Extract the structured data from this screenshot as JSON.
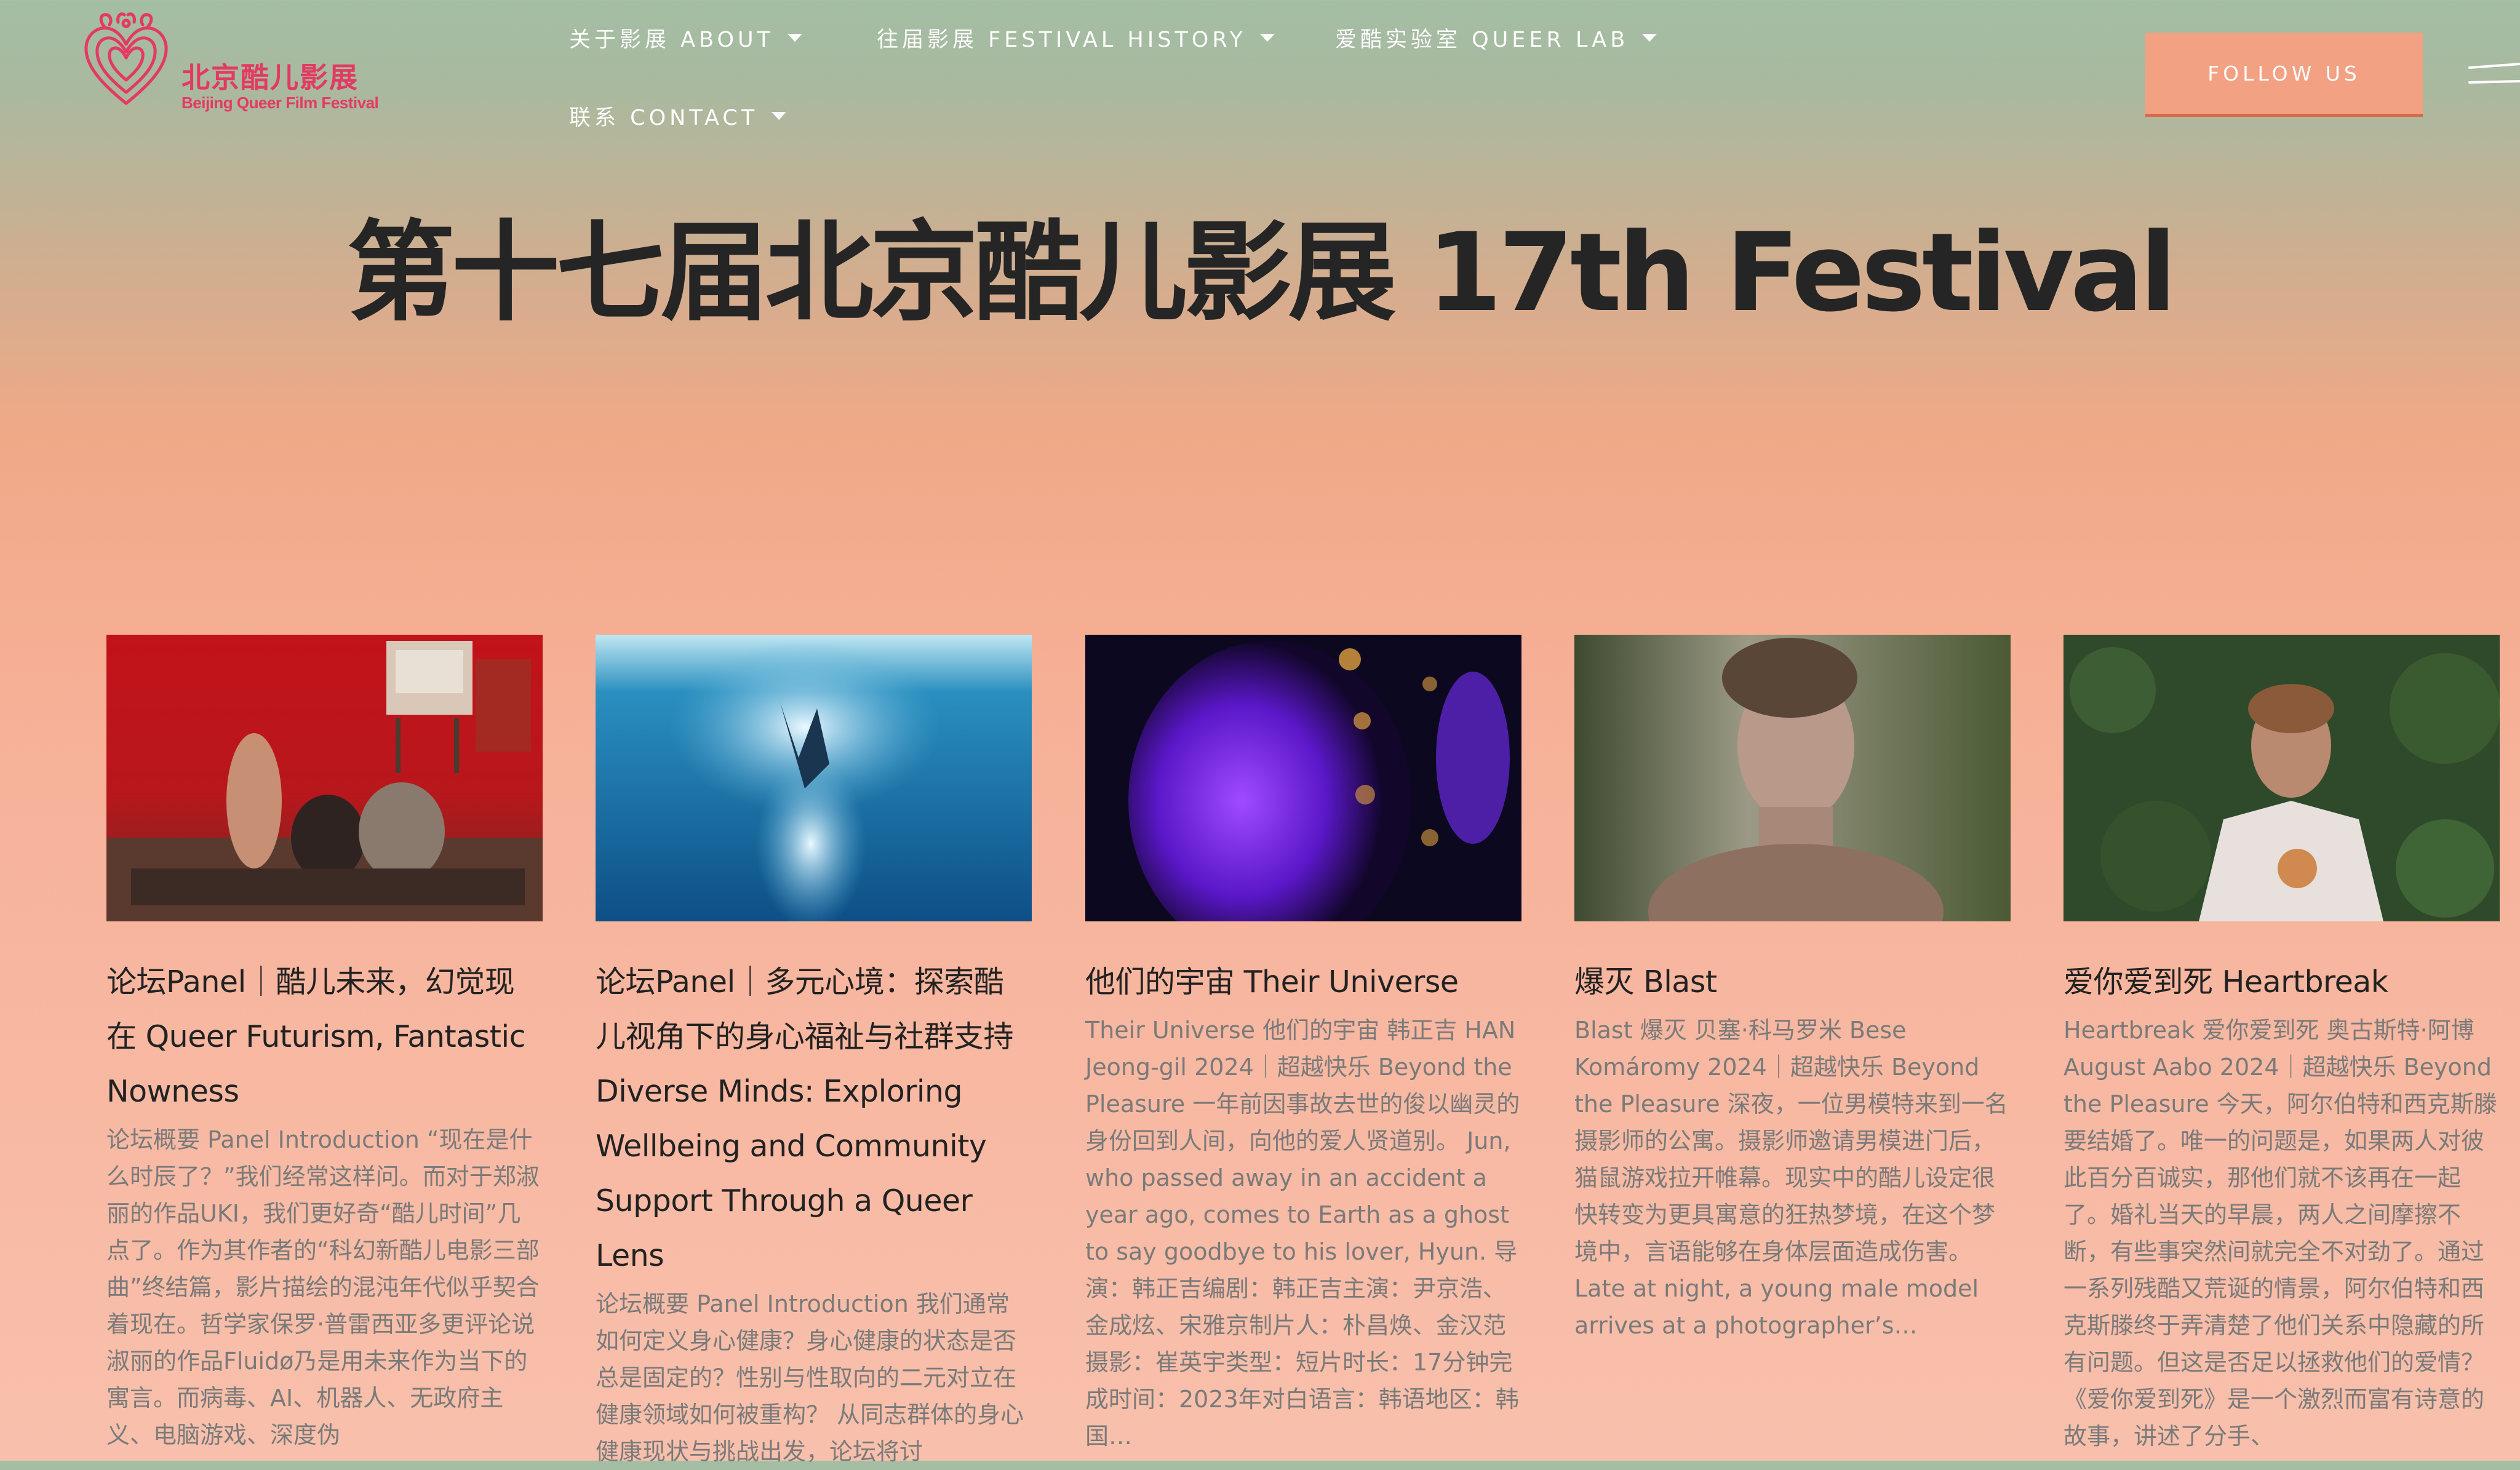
{
  "logo": {
    "name_cn": "北京酷儿影展",
    "name_en": "Beijing Queer Film Festival"
  },
  "nav": {
    "items": [
      {
        "label": "关于影展 ABOUT"
      },
      {
        "label": "往届影展 FESTIVAL HISTORY"
      },
      {
        "label": "爱酷实验室 QUEER LAB"
      },
      {
        "label": "联系 CONTACT"
      }
    ],
    "follow_label": "FOLLOW US"
  },
  "page_title": "第十七届北京酷儿影展 17th Festival",
  "cards": [
    {
      "title": "论坛Panel｜酷儿未来，幻觉现在 Queer Futurism, Fantastic Nowness",
      "excerpt": "论坛概要 Panel Introduction “现在是什么时辰了？”我们经常这样问。而对于郑淑丽的作品UKI，我们更好奇“酷儿时间”几点了。作为其作者的“科幻新酷儿电影三部曲”终结篇，影片描绘的混沌年代似乎契合着现在。哲学家保罗·普雷西亚多更评论说淑丽的作品Fluidø乃是用未来作为当下的寓言。而病毒、AI、机器人、无政府主义、电脑游戏、深度伪"
    },
    {
      "title": "论坛Panel｜多元心境：探索酷儿视角下的身心福祉与社群支持 Diverse Minds: Exploring Wellbeing and Community Support Through a Queer Lens",
      "excerpt": "论坛概要 Panel Introduction 我们通常如何定义身心健康？身心健康的状态是否总是固定的？性别与性取向的二元对立在健康领域如何被重构？ 从同志群体的身心健康现状与挑战出发，论坛将讨"
    },
    {
      "title": "他们的宇宙 Their Universe",
      "excerpt": "Their Universe 他们的宇宙 韩正吉 HAN Jeong-gil 2024｜超越快乐 Beyond the Pleasure 一年前因事故去世的俊以幽灵的身份回到人间，向他的爱人贤道别。 Jun, who passed away in an accident a year ago, comes to Earth as a ghost to say goodbye to his lover, Hyun. 导演：韩正吉编剧：韩正吉主演：尹京浩、金成炫、宋雅京制片人：朴昌焕、金汉范摄影：崔英宇类型：短片时长：17分钟完成时间：2023年对白语言：韩语地区：韩国…"
    },
    {
      "title": "爆灭 Blast",
      "excerpt": "Blast 爆灭 贝塞·科马罗米 Bese Komáromy 2024｜超越快乐 Beyond the Pleasure 深夜，一位男模特来到一名摄影师的公寓。摄影师邀请男模进门后，猫鼠游戏拉开帷幕。现实中的酷儿设定很快转变为更具寓意的狂热梦境，在这个梦境中，言语能够在身体层面造成伤害。 Late at night, a young male model arrives at a photographer’s…"
    },
    {
      "title": "爱你爱到死 Heartbreak",
      "excerpt": "Heartbreak 爱你爱到死 奥古斯特·阿博 August Aabo 2024｜超越快乐 Beyond the Pleasure 今天，阿尔伯特和西克斯滕要结婚了。唯一的问题是，如果两人对彼此百分百诚实，那他们就不该再在一起了。婚礼当天的早晨，两人之间摩擦不断，有些事突然间就完全不对劲了。通过一系列残酷又荒诞的情景，阿尔伯特和西克斯滕终于弄清楚了他们关系中隐藏的所有问题。但这是否足以拯救他们的爱情？《爱你爱到死》是一个激烈而富有诗意的故事，讲述了分手、"
    }
  ],
  "colors": {
    "accent": "#e23a63",
    "follow_button": "#f2a183",
    "title_text": "#252525",
    "excerpt_text": "#7a7a7a"
  }
}
